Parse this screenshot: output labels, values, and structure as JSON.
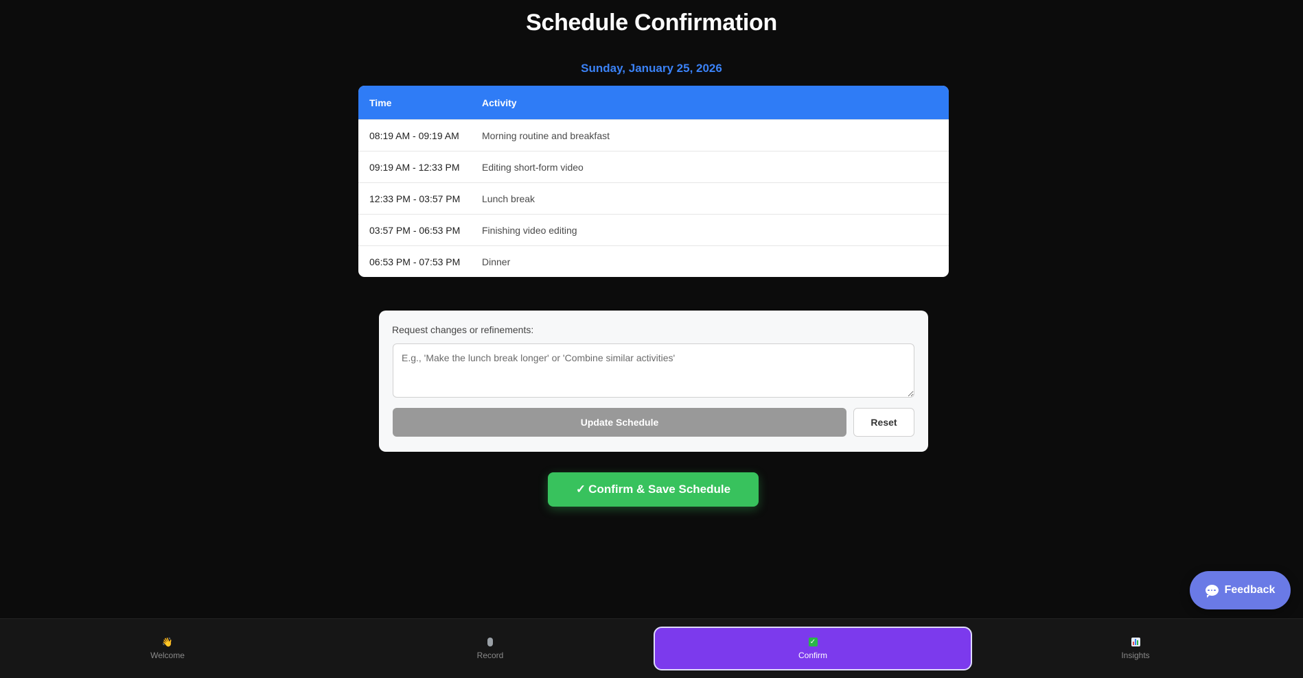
{
  "page": {
    "title": "Schedule Confirmation",
    "date": "Sunday, January 25, 2026"
  },
  "schedule_table": {
    "headers": {
      "time": "Time",
      "activity": "Activity"
    },
    "rows": [
      {
        "time": "08:19 AM - 09:19 AM",
        "activity": "Morning routine and breakfast"
      },
      {
        "time": "09:19 AM - 12:33 PM",
        "activity": "Editing short-form video"
      },
      {
        "time": "12:33 PM - 03:57 PM",
        "activity": "Lunch break"
      },
      {
        "time": "03:57 PM - 06:53 PM",
        "activity": "Finishing video editing"
      },
      {
        "time": "06:53 PM - 07:53 PM",
        "activity": "Dinner"
      }
    ]
  },
  "refine": {
    "label": "Request changes or refinements:",
    "placeholder": "E.g., 'Make the lunch break longer' or 'Combine similar activities'",
    "value": "",
    "update_label": "Update Schedule",
    "reset_label": "Reset"
  },
  "confirm": {
    "icon": "✓",
    "label": "Confirm & Save Schedule",
    "color": "#38c25d"
  },
  "feedback": {
    "icon": "chat-bubble-icon",
    "label": "Feedback",
    "color": "#6a7ae6"
  },
  "nav": {
    "items": [
      {
        "id": "welcome",
        "icon": "waving-hand-icon",
        "glyph": "👋",
        "label": "Welcome",
        "active": false
      },
      {
        "id": "record",
        "icon": "microphone-icon",
        "glyph": "🎙",
        "label": "Record",
        "active": false
      },
      {
        "id": "confirm",
        "icon": "check-mark-icon",
        "glyph": "✓",
        "label": "Confirm",
        "active": true
      },
      {
        "id": "insights",
        "icon": "bar-chart-icon",
        "glyph": "📊",
        "label": "Insights",
        "active": false
      }
    ],
    "active_color": "#7c3aed"
  },
  "colors": {
    "background": "#0c0c0c",
    "accent_blue": "#2f7cf6",
    "date_blue": "#3b82f6"
  }
}
